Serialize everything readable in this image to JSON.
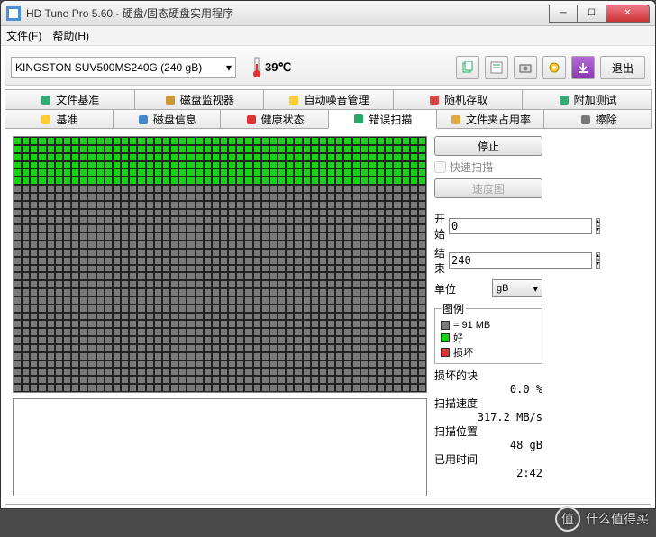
{
  "window": {
    "title": "HD Tune Pro 5.60 - 硬盘/固态硬盘实用程序"
  },
  "menu": {
    "file": "文件(F)",
    "help": "帮助(H)"
  },
  "toolbar": {
    "drive": "KINGSTON SUV500MS240G (240 gB)",
    "temp": "39℃",
    "exit": "退出"
  },
  "tabs_row1": [
    {
      "label": "文件基准",
      "icon": "file-benchmark"
    },
    {
      "label": "磁盘监视器",
      "icon": "disk-monitor"
    },
    {
      "label": "自动噪音管理",
      "icon": "aam"
    },
    {
      "label": "随机存取",
      "icon": "random-access"
    },
    {
      "label": "附加测试",
      "icon": "extra-tests"
    }
  ],
  "tabs_row2": [
    {
      "label": "基准",
      "icon": "benchmark"
    },
    {
      "label": "磁盘信息",
      "icon": "info"
    },
    {
      "label": "健康状态",
      "icon": "health"
    },
    {
      "label": "错误扫描",
      "icon": "error-scan",
      "active": true
    },
    {
      "label": "文件夹占用率",
      "icon": "folder-usage"
    },
    {
      "label": "擦除",
      "icon": "erase"
    }
  ],
  "scan": {
    "stop": "停止",
    "quick": "快速扫描",
    "speedmap": "速度图",
    "start_label": "开始",
    "start_val": "0",
    "end_label": "结束",
    "end_val": "240",
    "unit_label": "单位",
    "unit_val": "gB",
    "legend_title": "图例",
    "legend_size": "= 91 MB",
    "legend_ok": "好",
    "legend_bad": "损坏",
    "damaged_label": "损坏的块",
    "damaged_val": "0.0 %",
    "speed_label": "扫描速度",
    "speed_val": "317.2 MB/s",
    "pos_label": "扫描位置",
    "pos_val": "48 gB",
    "elapsed_label": "已用时间",
    "elapsed_val": "2:42"
  },
  "grid": {
    "cols": 50,
    "rows": 32,
    "scanned_rows": 6
  },
  "watermark": "什么值得买"
}
